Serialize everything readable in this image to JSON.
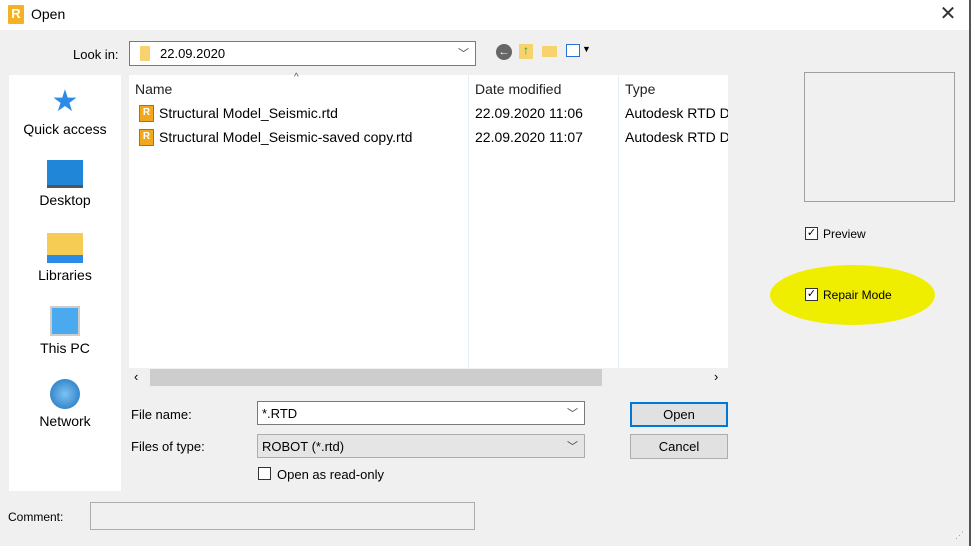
{
  "window": {
    "title": "Open",
    "close_icon": "close-icon"
  },
  "toolbar": {
    "look_in_label": "Look in:",
    "look_in_value": "22.09.2020",
    "icons": [
      "back-icon",
      "up-folder-icon",
      "new-folder-icon",
      "view-menu-icon"
    ]
  },
  "sidebar": {
    "items": [
      {
        "label": "Quick access",
        "icon": "star-icon"
      },
      {
        "label": "Desktop",
        "icon": "desktop-icon"
      },
      {
        "label": "Libraries",
        "icon": "libraries-icon"
      },
      {
        "label": "This PC",
        "icon": "computer-icon"
      },
      {
        "label": "Network",
        "icon": "network-icon"
      }
    ]
  },
  "file_list": {
    "columns": [
      "Name",
      "Date modified",
      "Type"
    ],
    "rows": [
      {
        "name": "Structural Model_Seismic.rtd",
        "date": "22.09.2020 11:06",
        "type": "Autodesk RTD D"
      },
      {
        "name": "Structural Model_Seismic-saved copy.rtd",
        "date": "22.09.2020 11:07",
        "type": "Autodesk RTD D"
      }
    ]
  },
  "form": {
    "file_name_label": "File name:",
    "file_name_value": "*.RTD",
    "file_type_label": "Files of type:",
    "file_type_value": "ROBOT (*.rtd)",
    "read_only_label": "Open as read-only",
    "open_label": "Open",
    "cancel_label": "Cancel",
    "comment_label": "Comment:",
    "comment_value": ""
  },
  "options": {
    "preview_label": "Preview",
    "preview_checked": true,
    "repair_label": "Repair Mode",
    "repair_checked": true
  },
  "colors": {
    "highlight": "#f0ee00",
    "app_icon": "#f4b223"
  }
}
